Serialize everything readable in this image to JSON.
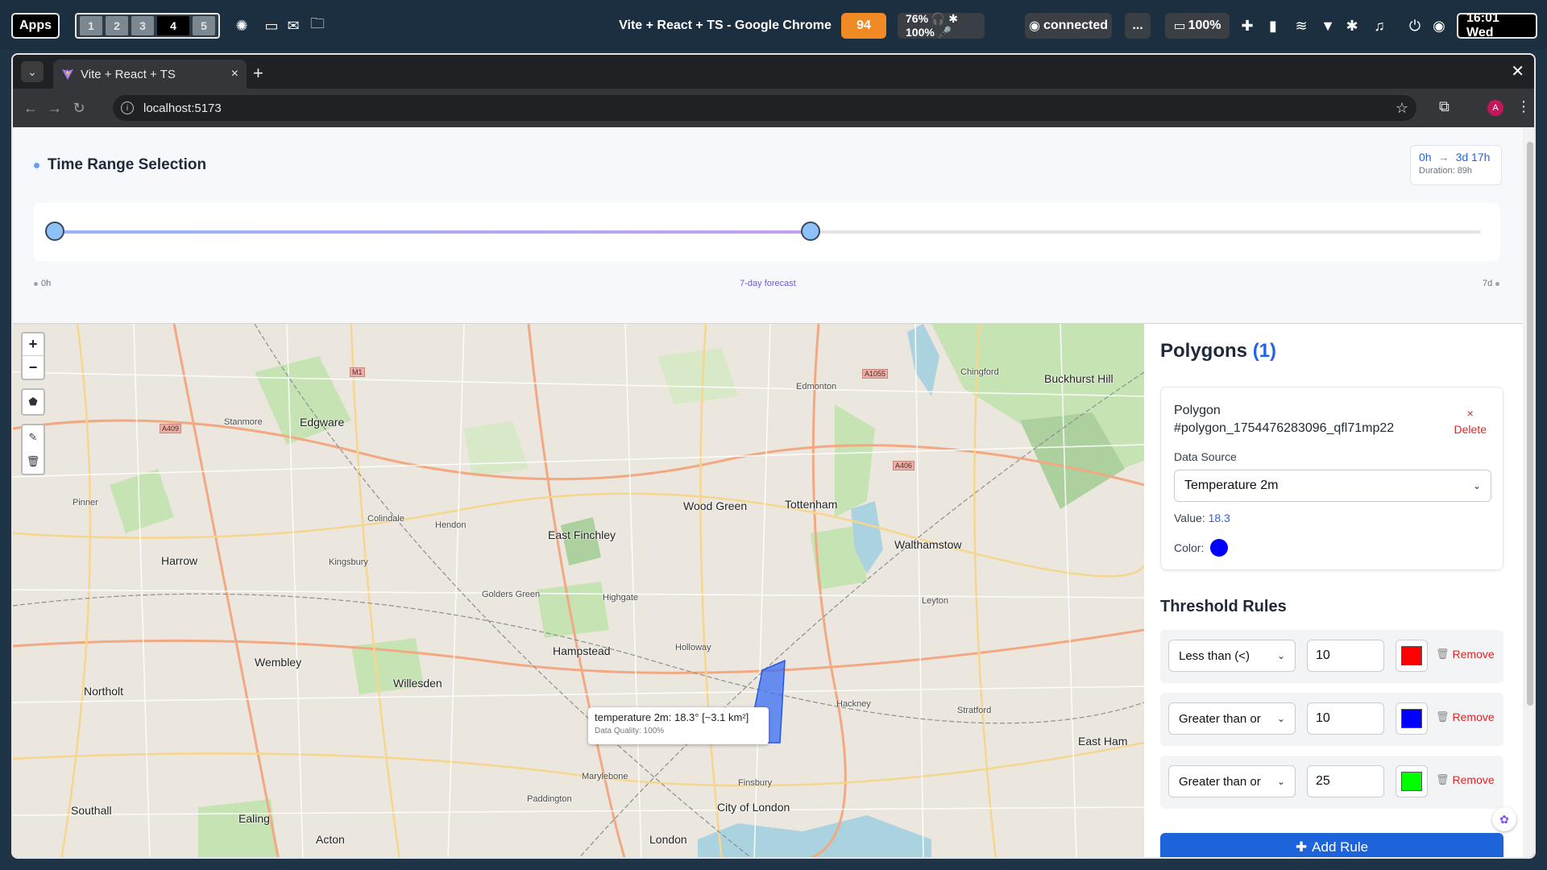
{
  "desktop": {
    "apps_label": "Apps",
    "workspaces": [
      "1",
      "2",
      "3",
      "4",
      "5"
    ],
    "active_workspace": "4",
    "window_title": "Vite + React + TS - Google Chrome",
    "updates_badge": "94",
    "media_status": "76% 🎧 ✱ 100% 🎤",
    "connection_status": "connected",
    "more_label": "...",
    "battery": "100%",
    "clock": "16:01 Wed"
  },
  "browser": {
    "tab_title": "Vite + React + TS",
    "url": "localhost:5173",
    "profile_initial": "A"
  },
  "time_range": {
    "title": "Time Range Selection",
    "start_label": "0h",
    "end_label": "3d 17h",
    "duration": "Duration: 89h",
    "axis_start": "0h",
    "axis_center": "7-day forecast",
    "axis_end": "7d",
    "range_start_fraction": 0.0,
    "range_end_fraction": 0.53
  },
  "map": {
    "zoom_in": "+",
    "zoom_out": "−",
    "tooltip_main": "temperature 2m: 18.3° [~3.1 km²]",
    "tooltip_quality": "Data Quality: 100%",
    "labels": {
      "edgware": "Edgware",
      "harrow": "Harrow",
      "hendon": "Hendon",
      "finchley": "East Finchley",
      "wood_green": "Wood Green",
      "tottenham": "Tottenham",
      "walthamstow": "Walthamstow",
      "wembley": "Wembley",
      "hampstead": "Hampstead",
      "willesden": "Willesden",
      "ealing": "Ealing",
      "london": "London",
      "city_of_london": "City of London",
      "stanmore": "Stanmore",
      "edmonton": "Edmonton",
      "enfield_road": "A1055",
      "road_a406": "A406",
      "road_a409": "A409",
      "road_m1": "M1",
      "southall": "Southall",
      "acton": "Acton",
      "northolt": "Northolt",
      "golders_green": "Golders Green",
      "highgate": "Highgate",
      "hackney": "Hackney",
      "stratford": "Stratford",
      "leyton": "Leyton",
      "chingford": "Chingford",
      "buckhurst_hill": "Buckhurst Hill",
      "east_ham": "East Ham",
      "holloway": "Holloway",
      "islington": "Finsbury",
      "paddington": "Paddington",
      "marylebone": "Marylebone",
      "kingsbury": "Kingsbury",
      "pinner": "Pinner",
      "colindale": "Colindale"
    }
  },
  "sidebar": {
    "title": "Polygons",
    "count": "(1)",
    "polygon": {
      "name_prefix": "Polygon",
      "id": "#polygon_1754476283096_qfl71mp22",
      "delete_icon": "×",
      "delete_label": "Delete",
      "data_source_label": "Data Source",
      "data_source_value": "Temperature 2m",
      "value_label": "Value:",
      "value": "18.3",
      "color_label": "Color:",
      "color": "#0000ff"
    },
    "rules_title": "Threshold Rules",
    "rules": [
      {
        "operator": "Less than (<)",
        "value": "10",
        "color": "#ff0000",
        "remove_label": "Remove"
      },
      {
        "operator": "Greater than or",
        "value": "10",
        "color": "#0000ff",
        "remove_label": "Remove"
      },
      {
        "operator": "Greater than or",
        "value": "25",
        "color": "#00ff00",
        "remove_label": "Remove"
      }
    ],
    "add_rule_label": "Add Rule"
  }
}
